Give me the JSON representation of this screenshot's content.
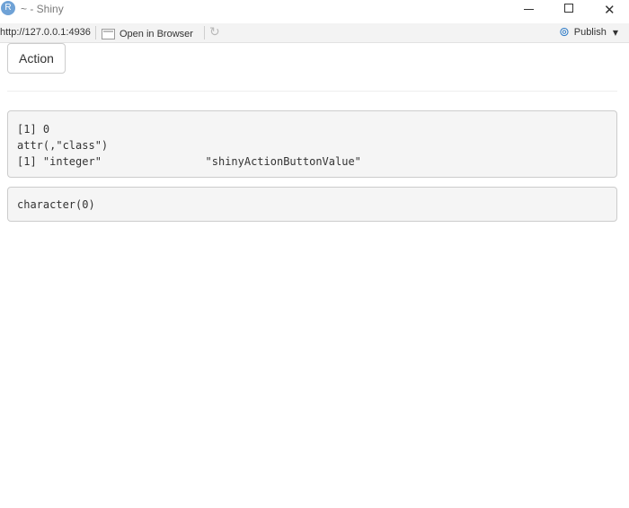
{
  "window": {
    "icon_letter": "R",
    "title": "~ - Shiny",
    "minimize_icon": "minimize-icon",
    "maximize_icon": "maximize-icon",
    "close_glyph": "✕"
  },
  "toolbar": {
    "url": "http://127.0.0.1:4936",
    "open_in_browser": "Open in Browser",
    "refresh_glyph": "↻",
    "publish_label": "Publish",
    "publish_glyph": "⊚",
    "publish_caret": "▼"
  },
  "main": {
    "action_button_label": "Action",
    "output1_lines": "[1] 0\nattr(,\"class\")\n[1] \"integer\"                \"shinyActionButtonValue\"",
    "output2_text": "character(0)"
  },
  "colors": {
    "accent_blue": "#2e7bc7",
    "pre_background": "#f5f5f5",
    "pre_border": "#cccccc"
  }
}
